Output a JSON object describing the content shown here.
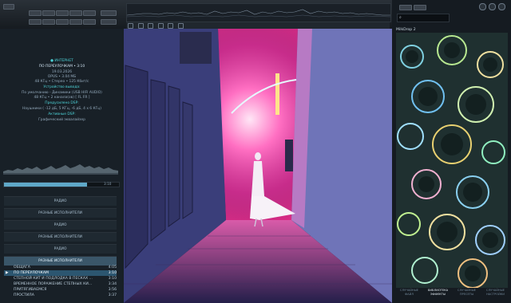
{
  "toolbar": {
    "buttons": [
      {
        "label": "ВОСПРОИЗВЕДЕНИЕ"
      },
      {
        "label": "СПИСОК ФАЙЛОВ"
      },
      {
        "label": "ДОБАВИТЬ ФАЙЛЫ"
      },
      {
        "label": "ДОБАВИТЬ ПАПКУ"
      },
      {
        "label": "ПЛЕЙЛИСТЫ"
      },
      {
        "label": "ЭКВАЛАЙЗЕР"
      }
    ]
  },
  "now_playing": {
    "source": "ИНТЕРНЕТ",
    "title": "ПО ПЕРЕУЛОЧКАМ • 3:10",
    "date": "19.03.2026",
    "format": "OPUS • 3.04 МБ",
    "quality": "48 КГц • Стерео • 125 Кбит/с",
    "output_header": "Устройство вывода:",
    "output_device": "По умолчанию - Динамики (USB HIFI AUDIO)",
    "output_format": "48 КГц • 2 канала(ов) [ FL FR ]",
    "dsp_header": "Предусилено DSP:",
    "dsp_value": "Наушники ( -12 дБ, 5 КГц, -6 дБ, 4 x 6 КГц)",
    "active_dsp": "Активные DSP:",
    "eq": "Графический эквалайзер",
    "time_total": "3:10",
    "progress": 0.72
  },
  "playlists": [
    {
      "label": "РАДИО",
      "active": false
    },
    {
      "label": "РАЗНЫЕ ИСПОЛНИТЕЛИ",
      "active": false
    },
    {
      "label": "РАДИО",
      "active": false
    },
    {
      "label": "РАЗНЫЕ ИСПОЛНИТЕЛИ",
      "active": false
    },
    {
      "label": "РАДИО",
      "active": false
    },
    {
      "label": "РАЗНЫЕ ИСПОЛНИТЕЛИ",
      "active": true
    }
  ],
  "tracks": [
    {
      "title": "ОБЩАГА",
      "duration": "4:05",
      "selected": false
    },
    {
      "title": "ПО ПЕРЕУЛОЧКАМ",
      "duration": "3:10",
      "selected": true
    },
    {
      "title": "СТЕПНОЙ КИТ И ПОДЛОДКА В ПЕСКАХ ...",
      "duration": "3:10",
      "selected": false
    },
    {
      "title": "ВРЕМЕННОЕ ПОРАЖЕНИЕ СТЕПНЫХ КИ...",
      "duration": "3:34",
      "selected": false
    },
    {
      "title": "ПРИТЯГИВАЕМСЯ",
      "duration": "3:56",
      "selected": false
    },
    {
      "title": "ПРОСТИЛА",
      "duration": "3:37",
      "selected": false
    }
  ],
  "visualizer": {
    "title": "MilkDrop 2"
  },
  "right_tabs": [
    {
      "line1": "СЛУЧАЙНЫЕ",
      "line2": "ФАЙЛ",
      "active": false
    },
    {
      "line1": "БИБЛИОТЕКА",
      "line2": "ЭФФЕКТЫ",
      "active": true
    },
    {
      "line1": "СЛУЧАЙНЫЕ",
      "line2": "ПРЕСЕТЫ",
      "active": false
    },
    {
      "line1": "СЛУЧАЙНЫЕ",
      "line2": "НАСТРОЙКИ",
      "active": false
    }
  ],
  "colors": {
    "accent": "#4dd3d8",
    "selection": "#2c5670",
    "neon": "#ff3ea0"
  }
}
